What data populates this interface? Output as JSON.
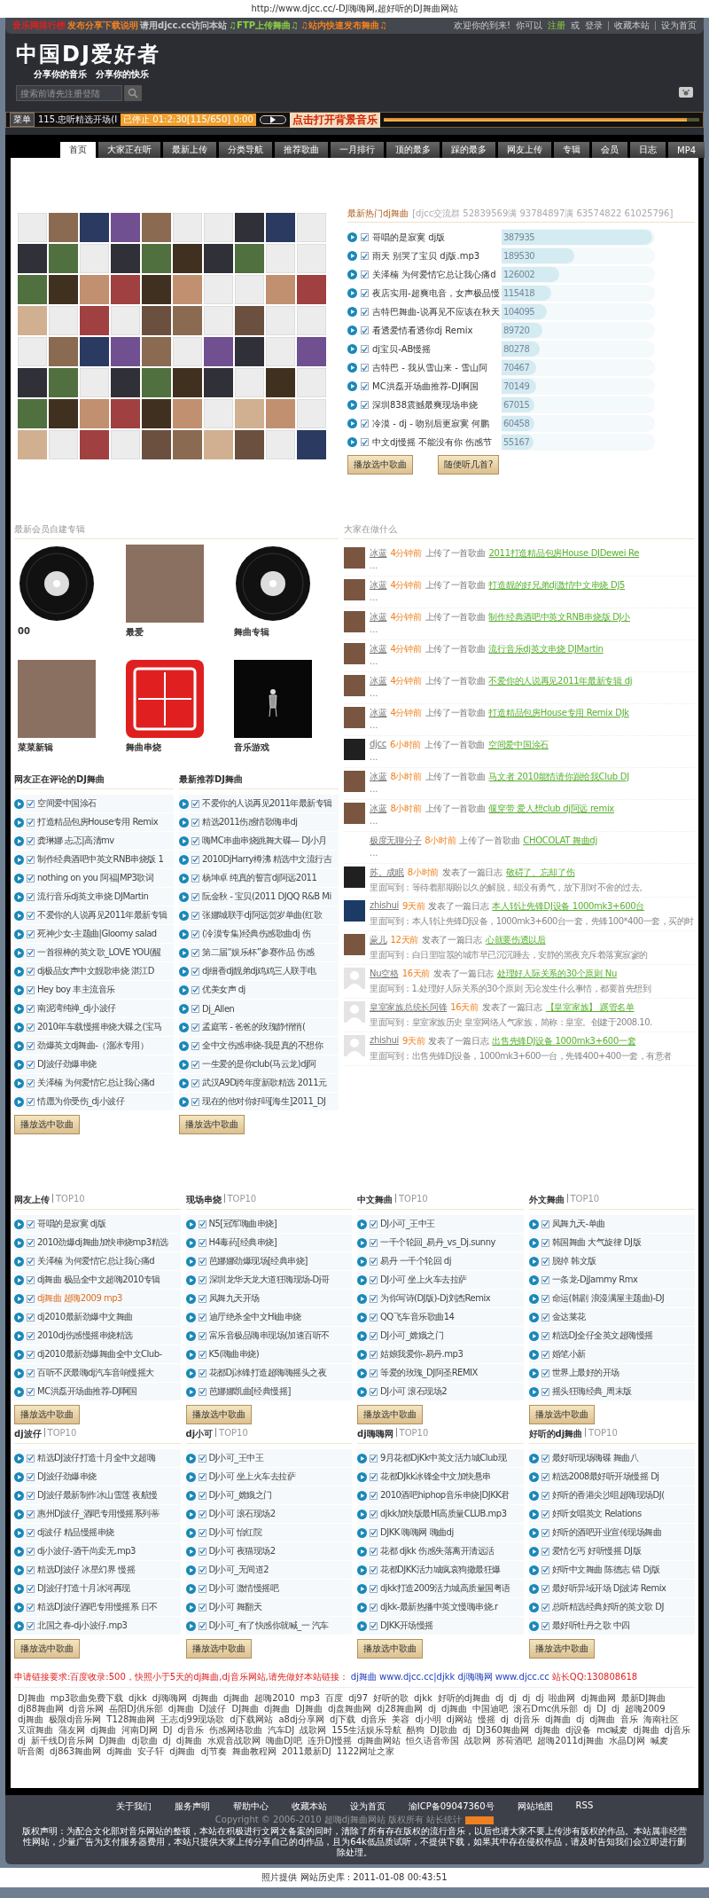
{
  "caption": "http://www.djcc.cc/-DJ嗨嗨网,超好听的DJ舞曲网站",
  "topbar": {
    "left": [
      {
        "text": "音乐网排行榜",
        "color": "#e02020"
      },
      {
        "text": "发布分享下载说明",
        "color": "#f08020"
      },
      {
        "text": "请用djcc.cc访问本站",
        "color": "#c8c8c8"
      },
      {
        "text": "♫FTP上传舞曲♫",
        "color": "#8ad040"
      },
      {
        "text": "♫站内快速发布舞曲♫",
        "color": "#f08020"
      }
    ],
    "welcome": "欢迎你的到来!",
    "can": "你可以",
    "register": "注册",
    "or": "或",
    "login": "登录",
    "links": [
      "收藏本站",
      "设为首页"
    ]
  },
  "logo": "中国DJ爱好者",
  "slogan": "分享你的音乐　分享你的快乐",
  "search": {
    "placeholder": "搜索前请先注册登陆"
  },
  "player": {
    "menu": "菜单",
    "track": "115.忠听精选开场(I",
    "status": "已停止 01:2:30[115/650] 0:00",
    "banner": "点击打开背景音乐",
    "level": 0.96
  },
  "tabs": [
    {
      "label": "首页",
      "selected": true
    },
    {
      "label": "大家正在听",
      "selected": false
    },
    {
      "label": "最新上传",
      "selected": false
    },
    {
      "label": "分类导航",
      "selected": false
    },
    {
      "label": "推荐歌曲",
      "selected": false
    },
    {
      "label": "一月排行",
      "selected": false
    },
    {
      "label": "顶的最多",
      "selected": false
    },
    {
      "label": "踩的最多",
      "selected": false
    },
    {
      "label": "网友上传",
      "selected": false
    },
    {
      "label": "专辑",
      "selected": false
    },
    {
      "label": "会员",
      "selected": false
    },
    {
      "label": "日志",
      "selected": false
    },
    {
      "label": "MP4",
      "selected": false
    }
  ],
  "hot": {
    "title": "最新热门dj舞曲",
    "group": "[djcc交流群 52839569满 93784897满 63574822 61025796]",
    "items": [
      {
        "title": "哥唱的是寂寞 dj版",
        "count": "387935",
        "level": 1,
        "checked": true
      },
      {
        "title": "雨天 别哭了宝贝 dj版.mp3",
        "count": "189530",
        "level": 0.48,
        "checked": true
      },
      {
        "title": "关泽楠 为何爱情它总让我心痛d",
        "count": "126002",
        "level": 0.38,
        "checked": true
      },
      {
        "title": "夜店实用-超爽电音，女声极品慢",
        "count": "115418",
        "level": 0.33,
        "checked": true
      },
      {
        "title": "吉特巴舞曲-说再见不应该在秋天",
        "count": "104095",
        "level": 0.3,
        "checked": true
      },
      {
        "title": "看透爱情看透你dj Remix",
        "count": "89720",
        "level": 0.27,
        "checked": true
      },
      {
        "title": "dj宝贝-AB慢摇",
        "count": "80278",
        "level": 0.25,
        "checked": true
      },
      {
        "title": "吉特巴 - 我从雪山来 - 雪山阿",
        "count": "70467",
        "level": 0.23,
        "checked": true
      },
      {
        "title": "MC洪磊开场曲推荐-DJ啊国",
        "count": "70149",
        "level": 0.23,
        "checked": true
      },
      {
        "title": "深圳838震撼最爽现场串烧",
        "count": "67015",
        "level": 0.22,
        "checked": true
      },
      {
        "title": "冷漠 - dj - 吻别后更寂寞 何鹏",
        "count": "60458",
        "level": 0.22,
        "checked": true
      },
      {
        "title": "中文dj慢摇 不能没有你 伤感节",
        "count": "55167",
        "level": 0.21,
        "checked": true
      }
    ],
    "buttons": [
      "播放选中歌曲",
      "随便听几首?"
    ]
  },
  "albums": {
    "title": "最新会员自建专辑",
    "items": [
      {
        "title": "00",
        "kind": "vinyl"
      },
      {
        "title": "最爱",
        "kind": "photo"
      },
      {
        "title": "舞曲专辑",
        "kind": "vinyl"
      },
      {
        "title": "菜菜新辑",
        "kind": "photo"
      },
      {
        "title": "舞曲串烧",
        "kind": "seal"
      },
      {
        "title": "音乐游戏",
        "kind": "dark"
      }
    ]
  },
  "lists": [
    {
      "title": "网友正在评论的DJ舞曲",
      "button": "播放选中歌曲",
      "items": [
        {
          "title": "空间爱中国涂石",
          "checked": true
        },
        {
          "title": "打造精品包房House专用 Remix",
          "checked": true
        },
        {
          "title": "龚琳娜 忐忑|高清mv",
          "checked": true
        },
        {
          "title": "制作经典酒吧中英文RNB串烧版 1",
          "checked": true
        },
        {
          "title": "nothing on you 阿福|MP3歌词",
          "checked": true
        },
        {
          "title": "流行音乐dj英文串烧 DJMartin",
          "checked": true
        },
        {
          "title": "不爱你的人说再见2011年最新专辑",
          "checked": true
        },
        {
          "title": "死神少女-主题曲|Gloomy salad",
          "checked": true
        },
        {
          "title": "一首很棒的英文歌_LOVE YOU(醒",
          "checked": true
        },
        {
          "title": "dj极品女声中文靓歌串烧 湛江D",
          "checked": true
        },
        {
          "title": "Hey boy 丰主流音乐",
          "checked": true
        },
        {
          "title": "南泥湾纯禅_dj小波仔",
          "checked": true
        },
        {
          "title": "2010年车载慢摇串烧大碟之(宝马",
          "checked": true
        },
        {
          "title": "劲爆英文dj舞曲-（溜冰专用）",
          "checked": true
        },
        {
          "title": "DJ波仔劲爆串烧",
          "checked": true
        },
        {
          "title": "关泽楠 为何爱情它总让我心痛d",
          "checked": true
        },
        {
          "title": "情愿为你受伤_dj小波仔",
          "checked": true
        }
      ]
    },
    {
      "title": "最新推荐DJ舞曲",
      "button": "播放选中歌曲",
      "items": [
        {
          "title": "不爱你的人说再见2011年最新专辑",
          "checked": true
        },
        {
          "title": "精选2011伤感情歌嗨串dj",
          "checked": true
        },
        {
          "title": "嗨MC串曲串烧跳舞大碟— DJ小月",
          "checked": true
        },
        {
          "title": "2010DjHarry樽沸 精选中文流行吉",
          "checked": true
        },
        {
          "title": "杨坤卓 纯真的誓言dj阿远2011",
          "checked": true
        },
        {
          "title": "阮金秋 - 宝贝(2011 DJQQ R&B Mi",
          "checked": true
        },
        {
          "title": "张娜城联手dj阿远贺岁单曲(红歌",
          "checked": true
        },
        {
          "title": "(冷漠专集)经典伤感歌曲dj 伤",
          "checked": true
        },
        {
          "title": "第二届“娱乐杯”参赛作品 伤感",
          "checked": true
        },
        {
          "title": "dj细香dj靓弟dj鸡鸡三人联手电",
          "checked": true
        },
        {
          "title": "优美女声 dj",
          "checked": true
        },
        {
          "title": "Dj_Allen",
          "checked": true
        },
        {
          "title": "孟庭苇 - 爸爸的玫瑰静悄悄(",
          "checked": true
        },
        {
          "title": "全中文伤感串烧-我是真的不想你",
          "checked": true
        },
        {
          "title": "一生爱的是你club(马云龙)dj阿",
          "checked": true
        },
        {
          "title": "武汉A9D跨年度新歌精选 2011元",
          "checked": true
        },
        {
          "title": "现在的他对你好吗[海生]2011_DJ",
          "checked": true
        }
      ]
    }
  ],
  "activity": {
    "title": "大家在做什么",
    "items": [
      {
        "kind": "photo",
        "user": "冰蓝",
        "time": "4分钟前",
        "action": "上传了一首歌曲",
        "link": "2011打造精品包房House DJDewei Re",
        "more": "..."
      },
      {
        "kind": "photo",
        "user": "冰蓝",
        "time": "4分钟前",
        "action": "上传了一首歌曲",
        "link": "打造靓的好兄弟dj激情中文串烧 DJ5",
        "more": "..."
      },
      {
        "kind": "photo",
        "user": "冰蓝",
        "time": "4分钟前",
        "action": "上传了一首歌曲",
        "link": "制作经典酒吧中英文RNB串烧版 DJ小",
        "more": "..."
      },
      {
        "kind": "photo",
        "user": "冰蓝",
        "time": "4分钟前",
        "action": "上传了一首歌曲",
        "link": "流行音乐dj英文串烧 DJMartin",
        "more": "..."
      },
      {
        "kind": "photo",
        "user": "冰蓝",
        "time": "4分钟前",
        "action": "上传了一首歌曲",
        "link": "不爱你的人说再见2011年最新专辑 dj",
        "more": "..."
      },
      {
        "kind": "photo",
        "user": "冰蓝",
        "time": "4分钟前",
        "action": "上传了一首歌曲",
        "link": "打造精品包房House专用 Remix DJk",
        "more": "..."
      },
      {
        "kind": "dark",
        "user": "djcc",
        "time": "6小时前",
        "action": "上传了一首歌曲",
        "link": "空间爱中国涂石",
        "more": "..."
      },
      {
        "kind": "photo",
        "user": "冰蓝",
        "time": "8小时前",
        "action": "上传了一首歌曲",
        "link": "马文者 2010能情请你跟给我Club DJ",
        "more": "..."
      },
      {
        "kind": "photo",
        "user": "冰蓝",
        "time": "8小时前",
        "action": "上传了一首歌曲",
        "link": "偃穿带 爱人想club dj阿远 remix",
        "more": "..."
      },
      {
        "kind": "none",
        "user": "极度无聊分子",
        "time": "8小时前",
        "action": "上传了一首歌曲",
        "link": "CHOCOLAT 舞曲dj",
        "more": "..."
      },
      {
        "kind": "dark",
        "user": "苏。成眠",
        "time": "8小时前",
        "action": "发表了一篇日志",
        "link": "敬碍了、忘却了伤",
        "quote": "里面写到：等待着那期盼以久的解脱，却没有勇气，放下那对不舍的过去。"
      },
      {
        "kind": "blue",
        "user": "zhishui",
        "time": "9天前",
        "action": "发表了一篇日志",
        "link": "本人转让先锋DJ设备 1000mk3+600台",
        "quote": "里面写到：本人转让先锋DJ设备，1000mk3+600台一套，先锋100*400一套，买的时"
      },
      {
        "kind": "photo",
        "user": "蒙儿",
        "time": "12天前",
        "action": "发表了一篇日志",
        "link": "心就要伤透以后",
        "quote": "里面写到：白日里喧嚣的城市早已沉沉睡去，安静的黑夜充斥着落寞寂寥的"
      },
      {
        "kind": "default",
        "user": "Nu空格",
        "time": "16天前",
        "action": "发表了一篇日志",
        "link": "处理好人际关系的30个原则 Nu",
        "quote": "里面写到：1.处理好人际关系的30个原则 无论发生什么事情，都要首先想到"
      },
      {
        "kind": "default",
        "user": "皇室家族总统长阿锋",
        "time": "16天前",
        "action": "发表了一篇日志",
        "link": "【皇室家族】 蹊管名单",
        "quote": "里面写到：皇室家族历史 皇室网络人气家族，简称：皇室。创建于2008.10."
      },
      {
        "kind": "default",
        "user": "zhishui",
        "time": "9天前",
        "action": "发表了一篇日志",
        "link": "出售先锋DJ设备 1000mk3+600一套",
        "quote": "里面写到：出售先锋DJ设备，1000mk3+600一台，先锋400+400一套，有意者"
      }
    ]
  },
  "top10": [
    {
      "title": "网友上传",
      "tag": "TOP10",
      "button": "播放选中歌曲",
      "items": [
        {
          "title": "哥唱的是寂寞 dj版",
          "checked": true,
          "highlighted": false
        },
        {
          "title": "2010劲爆dj舞曲加快串烧mp3精选",
          "checked": true,
          "highlighted": false
        },
        {
          "title": "关泽楠 为何爱情它总让我心痛d",
          "checked": true,
          "highlighted": false
        },
        {
          "title": "dj舞曲 极品全中文超嗨2010专辑",
          "checked": true,
          "highlighted": false
        },
        {
          "title": "dj舞曲 超嗨2009 mp3",
          "checked": true,
          "highlighted": true
        },
        {
          "title": "dj2010最新劲爆中文舞曲",
          "checked": true,
          "highlighted": false
        },
        {
          "title": "2010dj伤感慢摇串烧精选",
          "checked": true,
          "highlighted": false
        },
        {
          "title": "dj2010最新劲爆舞曲全中文Club-",
          "checked": true,
          "highlighted": false
        },
        {
          "title": "百听不厌最嗨dj汽车音响慢摇大",
          "checked": true,
          "highlighted": false
        },
        {
          "title": "MC洪磊开场曲推荐-DJ啊国",
          "checked": true,
          "highlighted": false
        }
      ]
    },
    {
      "title": "现场串烧",
      "tag": "TOP10",
      "button": "播放选中歌曲",
      "items": [
        {
          "title": "N5[冠军嗨曲串烧]",
          "checked": true,
          "highlighted": false
        },
        {
          "title": "H4毒药[经典串烧]",
          "checked": true,
          "highlighted": false
        },
        {
          "title": "芭娜娜劲爆现场[经典串烧]",
          "checked": true,
          "highlighted": false
        },
        {
          "title": "深圳龙华天龙大道狂嗨现场-Dj哥",
          "checked": true,
          "highlighted": false
        },
        {
          "title": "凤舞九天开场",
          "checked": true,
          "highlighted": false
        },
        {
          "title": "迪厅绝杀全中文Hi曲串烧",
          "checked": true,
          "highlighted": false
        },
        {
          "title": "富乐音极品嗨串现场(加速百听不",
          "checked": true,
          "highlighted": false
        },
        {
          "title": "K5(嗨曲串烧)",
          "checked": true,
          "highlighted": false
        },
        {
          "title": "花都Dj冰锋打造超嗨嗨摇头之夜",
          "checked": true,
          "highlighted": false
        },
        {
          "title": "芭娜娜凯曲[经典慢摇]",
          "checked": true,
          "highlighted": false
        }
      ]
    },
    {
      "title": "中文舞曲",
      "tag": "TOP10",
      "button": "播放选中歌曲",
      "items": [
        {
          "title": "DJ小可_王中王",
          "checked": true,
          "highlighted": false
        },
        {
          "title": "一千个轮回_易丹_vs_Dj.sunny",
          "checked": true,
          "highlighted": false
        },
        {
          "title": "易丹 一千个轮回 dj",
          "checked": true,
          "highlighted": false
        },
        {
          "title": "DJ小可 坐上火车去拉萨",
          "checked": true,
          "highlighted": false
        },
        {
          "title": "为你写诗(DJ版)-Dj刘杰Remix",
          "checked": true,
          "highlighted": false
        },
        {
          "title": "QQ飞车音乐歌曲14",
          "checked": true,
          "highlighted": false
        },
        {
          "title": "DJ小可_嫦娥之门",
          "checked": true,
          "highlighted": false
        },
        {
          "title": "姑娘我爱你-易丹.mp3",
          "checked": true,
          "highlighted": false
        },
        {
          "title": "等爱的玫瑰_DJ阿圣REMIX",
          "checked": true,
          "highlighted": false
        },
        {
          "title": "DJ小可 滚石现场2",
          "checked": true,
          "highlighted": false
        }
      ]
    },
    {
      "title": "外文舞曲",
      "tag": "TOP10",
      "button": "播放选中歌曲",
      "items": [
        {
          "title": "凤舞九天-单曲",
          "checked": true,
          "highlighted": false
        },
        {
          "title": "韩国舞曲 大气旋律 DJ版",
          "checked": true,
          "highlighted": false
        },
        {
          "title": "脱掉 韩文版",
          "checked": true,
          "highlighted": false
        },
        {
          "title": "一条龙-DjJammy Rmx",
          "checked": true,
          "highlighted": false
        },
        {
          "title": "命运(韩剧 浪漫满屋主题曲)-DJ",
          "checked": true,
          "highlighted": false
        },
        {
          "title": "金达莱花",
          "checked": true,
          "highlighted": false
        },
        {
          "title": "精选DJ全仔全英文超嗨慢摇",
          "checked": true,
          "highlighted": false
        },
        {
          "title": "婚笔小新",
          "checked": true,
          "highlighted": false
        },
        {
          "title": "世界上最好的开场",
          "checked": true,
          "highlighted": false
        },
        {
          "title": "摇头狂嗨经典_周末版",
          "checked": true,
          "highlighted": false
        }
      ]
    },
    {
      "title": "dj波仔",
      "tag": "TOP10",
      "button": "播放选中歌曲",
      "items": [
        {
          "title": "精选DJ波仔打造十月全中文超嗨",
          "checked": true,
          "highlighted": false
        },
        {
          "title": "DJ波仔劲爆串烧",
          "checked": true,
          "highlighted": false
        },
        {
          "title": "DJ波仔最新制作冰山雪莲 夜航慢",
          "checked": true,
          "highlighted": false
        },
        {
          "title": "惠州Dj波仔_酒吧专用慢摇系列蒂",
          "checked": true,
          "highlighted": false
        },
        {
          "title": "dj波仔 精品慢摇串烧",
          "checked": true,
          "highlighted": false
        },
        {
          "title": "dj小波仔-酒干尚卖无.mp3",
          "checked": true,
          "highlighted": false
        },
        {
          "title": "精选DJ波仔 冰星幻界 慢摇",
          "checked": true,
          "highlighted": false
        },
        {
          "title": "DJ波仔打造十月冰河再现",
          "checked": true,
          "highlighted": false
        },
        {
          "title": "精选DJ波仔酒吧专用慢摇系 日不",
          "checked": true,
          "highlighted": false
        },
        {
          "title": "北国之春-dj小波仔.mp3",
          "checked": true,
          "highlighted": false
        }
      ]
    },
    {
      "title": "dj小可",
      "tag": "TOP10",
      "button": "播放选中歌曲",
      "items": [
        {
          "title": "DJ小可_王中王",
          "checked": true,
          "highlighted": false
        },
        {
          "title": "DJ小可 坐上火车去拉萨",
          "checked": true,
          "highlighted": false
        },
        {
          "title": "DJ小可_嫦娥之门",
          "checked": true,
          "highlighted": false
        },
        {
          "title": "DJ小可 滚石现场2",
          "checked": true,
          "highlighted": false
        },
        {
          "title": "DJ小可 怡红院",
          "checked": true,
          "highlighted": false
        },
        {
          "title": "DJ小可 夜猫现场2",
          "checked": true,
          "highlighted": false
        },
        {
          "title": "DJ小可_无间道2",
          "checked": true,
          "highlighted": false
        },
        {
          "title": "DJ小可 激情慢摇吧",
          "checked": true,
          "highlighted": false
        },
        {
          "title": "DJ小可 舞翻天",
          "checked": true,
          "highlighted": false
        },
        {
          "title": "DJ小可_有了快感你就喊_一 汽车",
          "checked": true,
          "highlighted": false
        }
      ]
    },
    {
      "title": "dj嗨嗨网",
      "tag": "TOP10",
      "button": "播放选中歌曲",
      "items": [
        {
          "title": "9月花都DjKk中英文活力城Club现",
          "checked": true,
          "highlighted": false
        },
        {
          "title": "花都DJkk冰锋全中文加快悬串",
          "checked": true,
          "highlighted": false
        },
        {
          "title": "2010酒吧hiphop音乐串烧|DJKK君",
          "checked": true,
          "highlighted": false
        },
        {
          "title": "djkk加快版最HI高质量CLUB.mp3",
          "checked": true,
          "highlighted": false
        },
        {
          "title": "DJKK 嗨嗨网 嗨曲dj",
          "checked": true,
          "highlighted": false
        },
        {
          "title": "花都 djkk 伤感失落离开清远活",
          "checked": true,
          "highlighted": false
        },
        {
          "title": "花都DJKK活力城疯哀狗撒最狂爆",
          "checked": true,
          "highlighted": false
        },
        {
          "title": "djkk打造2009活力城高质量国粤语",
          "checked": true,
          "highlighted": false
        },
        {
          "title": "djkk-最新热播中英文慢嗨串烧.r",
          "checked": true,
          "highlighted": false
        },
        {
          "title": "DJKK开场慢摇",
          "checked": true,
          "highlighted": false
        }
      ]
    },
    {
      "title": "好听的dj舞曲",
      "tag": "TOP10",
      "button": "播放选中歌曲",
      "items": [
        {
          "title": "最好听现场嗨碟 舞曲八",
          "checked": true,
          "highlighted": false
        },
        {
          "title": "精选2008最好听开场慢摇 Dj",
          "checked": true,
          "highlighted": false
        },
        {
          "title": "好听的香港尖沙咀超嗨现场DJ(",
          "checked": true,
          "highlighted": false
        },
        {
          "title": "好听女唱英文 Relations",
          "checked": true,
          "highlighted": false
        },
        {
          "title": "好听的酒吧开业宣传现场舞曲",
          "checked": true,
          "highlighted": false
        },
        {
          "title": "爱情乞丐 好听慢摇 DJ版",
          "checked": true,
          "highlighted": false
        },
        {
          "title": "好听中文舞曲 陈德志 错 Dj版",
          "checked": true,
          "highlighted": false
        },
        {
          "title": "最好听异域开场 Dj波涛 Remix",
          "checked": true,
          "highlighted": false
        },
        {
          "title": "总听精选经典好听的英文歌 DJ",
          "checked": true,
          "highlighted": false
        },
        {
          "title": "最好听牡丹之歌 中四",
          "checked": true,
          "highlighted": false
        }
      ]
    }
  ],
  "link_request": [
    {
      "kind": "text",
      "text": "申请链接要求:百度收录:500，快照小于5天的dj舞曲,dj音乐网站,请先做好本站链接："
    },
    {
      "kind": "link",
      "text": "dj舞曲 www.djcc.cc|djkk dj嗨嗨网 www.djcc.cc"
    },
    {
      "kind": "text",
      "text": "站长QQ:130808618"
    }
  ],
  "keywords": [
    "DJ舞曲",
    "mp3歌曲免费下载",
    "djkk",
    "dj嗨嗨网",
    "dj舞曲",
    "dj舞曲",
    "超嗨2010",
    "mp3",
    "百度",
    "dj97",
    "好听的歌",
    "djkk",
    "好听的dj舞曲",
    "dj",
    "dj",
    "dj",
    "dj",
    "啦曲网",
    "dj舞曲网",
    "最新DJ舞曲",
    "dj88舞曲网",
    "dj音乐网",
    "岳阳DJ俱乐部",
    "dj舞曲",
    "DJ波仔",
    "DJ舞曲",
    "dj舞曲",
    "DJ舞曲",
    "dj盘舞曲网",
    "dj28舞曲网",
    "dj",
    "dj舞曲",
    "中国迪吧",
    "滚石Dmc俱乐部",
    "dj",
    "DJ",
    "dj",
    "超嗨2009",
    "dj舞曲",
    "极限dj音乐网",
    "T128舞曲网",
    "王志dj99现场歌",
    "dj下载网站",
    "a8dj分享网",
    "dj下载",
    "dj音乐",
    "美容",
    "dj小明",
    "dj网站",
    "慢摇",
    "dj",
    "dj音乐",
    "dj舞曲",
    "dj",
    "dj舞曲",
    "音乐",
    "海南社区",
    "又谊舞曲",
    "蒲友网",
    "dj舞曲",
    "河南DJ网",
    "DJ",
    "dj音乐",
    "伤感网络歌曲",
    "汽车DJ",
    "战歌网",
    "155生活娱乐导航",
    "酷狗",
    "DJ歌曲",
    "dj",
    "DJ360舞曲网",
    "dj舞曲",
    "dj设备",
    "mc喊麦",
    "dj舞曲",
    "dj音乐",
    "dj",
    "新千线DJ音乐网",
    "DJ舞曲",
    "dj歌曲",
    "dj",
    "dj舞曲",
    "水观音战歌网",
    "嗨曲DJ吧",
    "连升DJ慢摇",
    "dj舞曲网站",
    "恒久语音帝国",
    "战歌网",
    "苏荷酒吧",
    "超嗨2011dj舞曲",
    "水晶DJ网",
    "喊麦",
    "听音阁",
    "dj863舞曲网",
    "dj舞曲",
    "安子轩",
    "dj舞曲",
    "dj节奏",
    "舞曲教程网",
    "2011最新DJ",
    "1122网址之家"
  ],
  "footer": {
    "links": [
      "关于我们",
      "服务声明",
      "帮助中心",
      "收藏本站",
      "设为首页",
      "渝ICP备09047360号",
      "网站地图",
      "RSS"
    ],
    "copyright": "Copyright © 2006-2010 超嗨dj舞曲网站 版权所有 站长统计",
    "disclaimer": "版权声明：为配合文化部对音乐网站的整顿，本站在积极进行文网文备案的同时，清除了所有存在版权的流行音乐，以后也请大家不要上传涉有版权的作品。本站属非经营性网站，少量广告为支付服务器费用，本站只提供大家上传分享自己的dj作品，且为64k低品质试听，不提供下载，如果其中存在侵权作品，请及时告知我们会立即进行删除处理。"
  },
  "bottom": "照片提供 网站历史库 : 2011-01-08 00:43:51"
}
